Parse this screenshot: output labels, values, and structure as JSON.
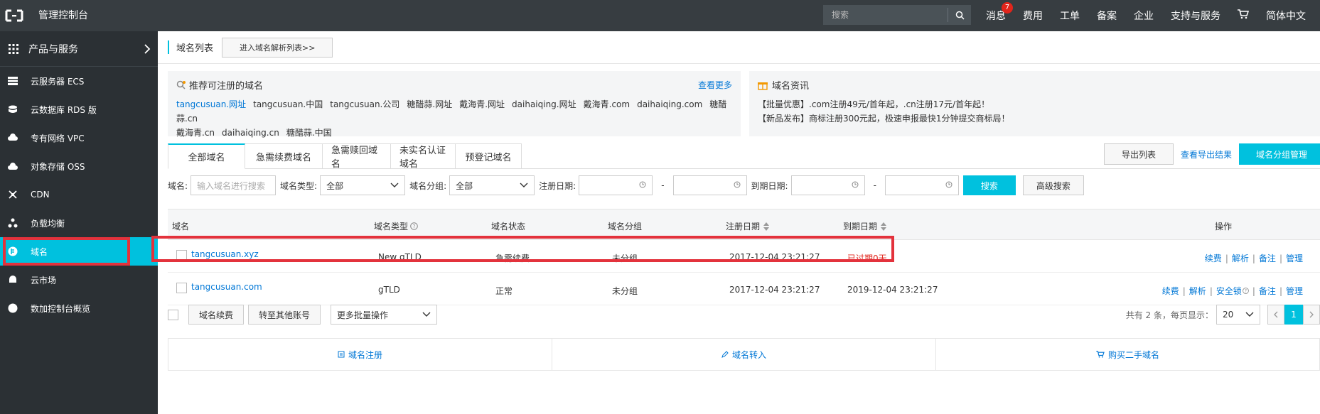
{
  "topbar": {
    "title": "管理控制台",
    "search_placeholder": "搜索",
    "nav": [
      {
        "label": "消息",
        "badge": "7"
      },
      {
        "label": "费用"
      },
      {
        "label": "工单"
      },
      {
        "label": "备案"
      },
      {
        "label": "企业"
      },
      {
        "label": "支持与服务"
      },
      {
        "label": "cart-icon"
      },
      {
        "label": "简体中文"
      }
    ]
  },
  "sidebar": {
    "head": "产品与服务",
    "items": [
      {
        "label": "云服务器 ECS",
        "icon": "server-icon"
      },
      {
        "label": "云数据库 RDS 版",
        "icon": "database-icon"
      },
      {
        "label": "专有网络 VPC",
        "icon": "cloud-network-icon"
      },
      {
        "label": "对象存储 OSS",
        "icon": "storage-icon"
      },
      {
        "label": "CDN",
        "icon": "cdn-icon"
      },
      {
        "label": "负载均衡",
        "icon": "load-balance-icon"
      },
      {
        "label": "域名",
        "icon": "domain-icon"
      },
      {
        "label": "云市场",
        "icon": "market-icon"
      },
      {
        "label": "数加控制台概览",
        "icon": "circle-icon"
      }
    ]
  },
  "breadcrumb": {
    "title": "域名列表",
    "button": "进入域名解析列表>>"
  },
  "recommend": {
    "title": "推荐可注册的域名",
    "more": "查看更多",
    "domains": [
      "tangcusuan.网址",
      "tangcusuan.中国",
      "tangcusuan.公司",
      "糖醋蒜.网址",
      "戴海青.网址",
      "daihaiqing.网址",
      "戴海青.com",
      "daihaiqing.com",
      "糖醋蒜.cn",
      "戴海青.cn",
      "daihaiqing.cn",
      "糖醋蒜.中国"
    ]
  },
  "news": {
    "title": "域名资讯",
    "items": [
      "【批量优惠】.com注册49元/首年起，.cn注册17元/首年起！",
      "【新品发布】商标注册300元起，极速申报最快1分钟提交商标局！"
    ]
  },
  "tabs": [
    "全部域名",
    "急需续费域名",
    "急需赎回域名",
    "未实名认证域名",
    "预登记域名"
  ],
  "actions": {
    "export": "导出列表",
    "view_export": "查看导出结果",
    "group_manage": "域名分组管理"
  },
  "filters": {
    "domain_label": "域名:",
    "domain_placeholder": "输入域名进行搜索",
    "type_label": "域名类型:",
    "type_value": "全部",
    "group_label": "域名分组:",
    "group_value": "全部",
    "reg_label": "注册日期:",
    "exp_label": "到期日期:",
    "dash": "-",
    "search": "搜索",
    "advanced": "高级搜索"
  },
  "table": {
    "headers": {
      "domain": "域名",
      "type": "域名类型",
      "status": "域名状态",
      "group": "域名分组",
      "reg": "注册日期",
      "exp": "到期日期",
      "ops": "操作"
    },
    "rows": [
      {
        "domain": "tangcusuan.xyz",
        "type": "New gTLD",
        "status": "急需续费",
        "group": "未分组",
        "reg": "2017-12-04 23:21:27",
        "exp": "已过期0天",
        "ops": [
          "续费",
          "解析",
          "备注",
          "管理"
        ]
      },
      {
        "domain": "tangcusuan.com",
        "type": "gTLD",
        "status": "正常",
        "group": "未分组",
        "reg": "2017-12-04 23:21:27",
        "exp": "2019-12-04 23:21:27",
        "ops": [
          "续费",
          "解析",
          "安全锁",
          "备注",
          "管理"
        ]
      }
    ]
  },
  "batch": {
    "renew": "域名续费",
    "transfer": "转至其他账号",
    "more": "更多批量操作",
    "total": "共有 2 条，每页显示：",
    "page_size": "20",
    "page": "1"
  },
  "quick": [
    "域名注册",
    "域名转入",
    "购买二手域名"
  ],
  "colors": {
    "accent": "#00c1de",
    "topbar": "#373d41",
    "sidebar": "#2b3034",
    "highlight": "#e3323c",
    "link": "#0077d6"
  }
}
